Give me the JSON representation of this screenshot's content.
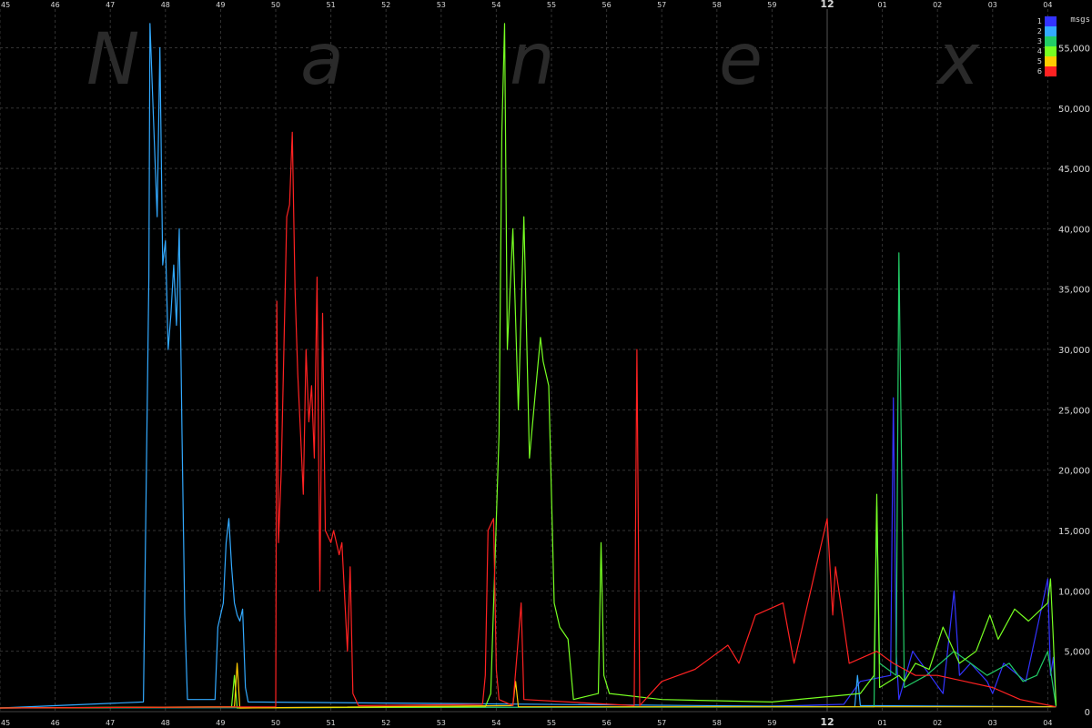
{
  "chart_data": {
    "type": "line",
    "watermark": [
      "N",
      "a",
      "n",
      "e",
      "x"
    ],
    "unit": "msgs",
    "x_ticks": [
      "45",
      "46",
      "47",
      "48",
      "49",
      "50",
      "51",
      "52",
      "53",
      "54",
      "55",
      "56",
      "57",
      "58",
      "59",
      "12",
      "01",
      "02",
      "03",
      "04"
    ],
    "major_tick": "12",
    "ylim": [
      0,
      60000
    ],
    "y_ticks": [
      5000,
      10000,
      15000,
      20000,
      25000,
      30000,
      35000,
      40000,
      45000,
      50000,
      55000
    ],
    "y_tick_labels": [
      "5,000",
      "10,000",
      "15,000",
      "20,000",
      "25,000",
      "30,000",
      "35,000",
      "40,000",
      "45,000",
      "50,000",
      "55,000"
    ],
    "y_zero_label": "0",
    "grid": true,
    "legend_position": "top-right",
    "series": [
      {
        "name": "1",
        "color": "#3333ff",
        "points": [
          [
            45,
            300
          ],
          [
            58.5,
            400
          ],
          [
            60.3,
            600
          ],
          [
            60.6,
            2500
          ],
          [
            61.15,
            3000
          ],
          [
            61.2,
            26000
          ],
          [
            61.25,
            5000
          ],
          [
            61.3,
            1000
          ],
          [
            61.55,
            5000
          ],
          [
            62.1,
            1500
          ],
          [
            62.3,
            10000
          ],
          [
            62.4,
            3000
          ],
          [
            62.6,
            4000
          ],
          [
            62.9,
            2500
          ],
          [
            63,
            1500
          ],
          [
            63.2,
            4000
          ],
          [
            63.6,
            2500
          ],
          [
            64,
            11000
          ],
          [
            64.05,
            3000
          ],
          [
            64.1,
            4500
          ],
          [
            64.15,
            500
          ]
        ]
      },
      {
        "name": "2",
        "color": "#33aaff",
        "points": [
          [
            45,
            300
          ],
          [
            47.6,
            800
          ],
          [
            47.7,
            36000
          ],
          [
            47.72,
            57000
          ],
          [
            47.8,
            47000
          ],
          [
            47.85,
            41000
          ],
          [
            47.9,
            55000
          ],
          [
            47.95,
            37000
          ],
          [
            48,
            39000
          ],
          [
            48.05,
            30000
          ],
          [
            48.1,
            33000
          ],
          [
            48.15,
            37000
          ],
          [
            48.2,
            32000
          ],
          [
            48.25,
            40000
          ],
          [
            48.3,
            23000
          ],
          [
            48.35,
            8000
          ],
          [
            48.4,
            1000
          ],
          [
            48.9,
            1000
          ],
          [
            48.95,
            7000
          ],
          [
            49.05,
            9000
          ],
          [
            49.1,
            14000
          ],
          [
            49.15,
            16000
          ],
          [
            49.2,
            12000
          ],
          [
            49.25,
            9000
          ],
          [
            49.3,
            8000
          ],
          [
            49.35,
            7500
          ],
          [
            49.4,
            8500
          ],
          [
            49.45,
            2000
          ],
          [
            49.5,
            800
          ],
          [
            60.5,
            400
          ],
          [
            60.55,
            3000
          ],
          [
            60.6,
            500
          ],
          [
            64.15,
            400
          ]
        ]
      },
      {
        "name": "3",
        "color": "#22cc66",
        "points": [
          [
            45,
            300
          ],
          [
            60.85,
            400
          ],
          [
            60.9,
            17000
          ],
          [
            60.95,
            4000
          ],
          [
            61.25,
            3000
          ],
          [
            61.3,
            38000
          ],
          [
            61.35,
            20000
          ],
          [
            61.4,
            2000
          ],
          [
            61.8,
            3000
          ],
          [
            62.3,
            5000
          ],
          [
            62.6,
            4000
          ],
          [
            62.9,
            3000
          ],
          [
            63.3,
            4000
          ],
          [
            63.55,
            2500
          ],
          [
            63.8,
            3000
          ],
          [
            64,
            5000
          ],
          [
            64.15,
            400
          ]
        ]
      },
      {
        "name": "4",
        "color": "#77ff22",
        "points": [
          [
            45,
            300
          ],
          [
            49.2,
            400
          ],
          [
            49.25,
            3000
          ],
          [
            49.3,
            300
          ],
          [
            53.8,
            400
          ],
          [
            53.9,
            1500
          ],
          [
            54.05,
            23000
          ],
          [
            54.1,
            48000
          ],
          [
            54.15,
            57000
          ],
          [
            54.2,
            30000
          ],
          [
            54.3,
            40000
          ],
          [
            54.4,
            25000
          ],
          [
            54.5,
            41000
          ],
          [
            54.6,
            21000
          ],
          [
            54.7,
            26000
          ],
          [
            54.8,
            31000
          ],
          [
            54.85,
            29000
          ],
          [
            54.95,
            27000
          ],
          [
            55.05,
            9000
          ],
          [
            55.15,
            7000
          ],
          [
            55.3,
            6000
          ],
          [
            55.4,
            1000
          ],
          [
            55.85,
            1500
          ],
          [
            55.9,
            14000
          ],
          [
            55.95,
            3000
          ],
          [
            56.05,
            1500
          ],
          [
            57,
            1000
          ],
          [
            59,
            800
          ],
          [
            60.6,
            1500
          ],
          [
            60.85,
            3000
          ],
          [
            60.9,
            18000
          ],
          [
            60.95,
            2000
          ],
          [
            61.3,
            3000
          ],
          [
            61.4,
            2500
          ],
          [
            61.6,
            4000
          ],
          [
            61.85,
            3500
          ],
          [
            62.1,
            7000
          ],
          [
            62.4,
            4000
          ],
          [
            62.7,
            5000
          ],
          [
            62.95,
            8000
          ],
          [
            63.1,
            6000
          ],
          [
            63.4,
            8500
          ],
          [
            63.65,
            7500
          ],
          [
            64,
            9000
          ],
          [
            64.05,
            11000
          ],
          [
            64.1,
            6000
          ],
          [
            64.15,
            500
          ]
        ]
      },
      {
        "name": "5",
        "color": "#ffcc00",
        "points": [
          [
            45,
            300
          ],
          [
            49.25,
            400
          ],
          [
            49.3,
            4000
          ],
          [
            49.35,
            300
          ],
          [
            54.3,
            500
          ],
          [
            54.35,
            2500
          ],
          [
            54.4,
            400
          ],
          [
            64.15,
            400
          ]
        ]
      },
      {
        "name": "6",
        "color": "#ff2222",
        "points": [
          [
            45,
            300
          ],
          [
            50,
            400
          ],
          [
            50.02,
            34000
          ],
          [
            50.05,
            14000
          ],
          [
            50.1,
            20000
          ],
          [
            50.2,
            41000
          ],
          [
            50.25,
            42000
          ],
          [
            50.3,
            48000
          ],
          [
            50.35,
            35000
          ],
          [
            50.4,
            28000
          ],
          [
            50.45,
            23000
          ],
          [
            50.5,
            18000
          ],
          [
            50.55,
            30000
          ],
          [
            50.6,
            24000
          ],
          [
            50.65,
            27000
          ],
          [
            50.7,
            21000
          ],
          [
            50.75,
            36000
          ],
          [
            50.8,
            10000
          ],
          [
            50.85,
            33000
          ],
          [
            50.9,
            15000
          ],
          [
            51,
            14000
          ],
          [
            51.05,
            15000
          ],
          [
            51.15,
            13000
          ],
          [
            51.2,
            14000
          ],
          [
            51.3,
            5000
          ],
          [
            51.35,
            12000
          ],
          [
            51.4,
            1500
          ],
          [
            51.5,
            500
          ],
          [
            53.75,
            600
          ],
          [
            53.8,
            3000
          ],
          [
            53.85,
            15000
          ],
          [
            53.95,
            16000
          ],
          [
            54,
            3500
          ],
          [
            54.05,
            1000
          ],
          [
            54.3,
            500
          ],
          [
            54.45,
            9000
          ],
          [
            54.5,
            1000
          ],
          [
            56.5,
            500
          ],
          [
            56.55,
            30000
          ],
          [
            56.6,
            500
          ],
          [
            57,
            2500
          ],
          [
            57.3,
            3000
          ],
          [
            57.6,
            3500
          ],
          [
            57.9,
            4500
          ],
          [
            58.2,
            5500
          ],
          [
            58.4,
            4000
          ],
          [
            58.7,
            8000
          ],
          [
            59.2,
            9000
          ],
          [
            59.4,
            4000
          ],
          [
            60,
            16000
          ],
          [
            60.1,
            8000
          ],
          [
            60.15,
            12000
          ],
          [
            60.4,
            4000
          ],
          [
            60.9,
            5000
          ],
          [
            61.2,
            4000
          ],
          [
            61.6,
            3000
          ],
          [
            62,
            3000
          ],
          [
            62.5,
            2500
          ],
          [
            63,
            2000
          ],
          [
            63.5,
            1000
          ],
          [
            64.15,
            400
          ]
        ]
      }
    ]
  }
}
